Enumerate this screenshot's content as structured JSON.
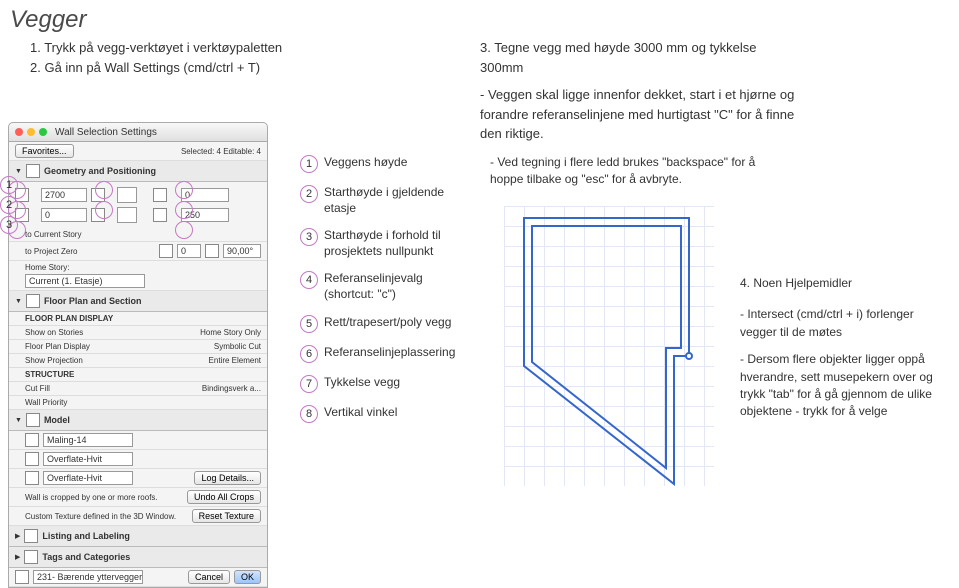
{
  "title": "Vegger",
  "steps_left": {
    "s1": "1. Trykk på vegg-verktøyet i verktøypaletten",
    "s2": "2. Gå inn på Wall Settings (cmd/ctrl + T)"
  },
  "step3": {
    "lead": "3. Tegne vegg med høyde 3000 mm og tykkelse 300mm",
    "d1": "- Veggen skal ligge innenfor dekket, start i et hjørne og forandre referanselinjene med hurtigtast \"C\" for å finne den riktige."
  },
  "note_backspace": "- Ved tegning i flere ledd brukes \"backspace\" for å hoppe tilbake og \"esc\" for å avbryte.",
  "help": {
    "title": "4. Noen Hjelpemidler",
    "p1": "- Intersect (cmd/ctrl + i) forlenger vegger til de møtes",
    "p2": "- Dersom flere objekter ligger oppå hverandre, sett musepekern over og trykk \"tab\" for å gå gjennom de ulike objektene - trykk for å velge"
  },
  "legend": {
    "i1": "Veggens høyde",
    "i2": "Starthøyde i gjeldende etasje",
    "i3": "Starthøyde i forhold til prosjektets nullpunkt",
    "i4": "Referanselinjevalg (shortcut: \"c\")",
    "i5": "Rett/trapesert/poly vegg",
    "i6": "Referanselinjeplassering",
    "i7": "Tykkelse vegg",
    "i8": "Vertikal vinkel"
  },
  "panel": {
    "window_title": "Wall Selection Settings",
    "favorites": "Favorites...",
    "selected": "Selected: 4 Editable: 4",
    "sec_geom": "Geometry and Positioning",
    "val_height": "2700",
    "val_offset": "0",
    "val_start": "0",
    "val_thick": "250",
    "to_current": "to Current Story",
    "to_zero": "to Project Zero",
    "val_zero": "0",
    "val_angle": "90,00°",
    "home_story": "Home Story:",
    "home_story_val": "Current (1. Etasje)",
    "sec_floor": "Floor Plan and Section",
    "fpd": "FLOOR PLAN DISPLAY",
    "show_on": "Show on Stories",
    "show_on_val": "Home Story Only",
    "fpd2": "Floor Plan Display",
    "fpd2_val": "Symbolic Cut",
    "show_proj": "Show Projection",
    "show_proj_val": "Entire Element",
    "structure": "STRUCTURE",
    "cut_fill": "Cut Fill",
    "cut_fill_val": "Bindingsverk a...",
    "wall_priority": "Wall Priority",
    "sec_model": "Model",
    "maling": "Maling-14",
    "overflate1": "Overflate-Hvit",
    "overflate2": "Overflate-Hvit",
    "crop_msg": "Wall is cropped by one or more roofs.",
    "undo_crops": "Undo All Crops",
    "log_details": "Log Details...",
    "custom_tex": "Custom Texture defined in the 3D Window.",
    "reset_tex": "Reset Texture",
    "sec_listing": "Listing and Labeling",
    "sec_tags": "Tags and Categories",
    "layer": "231- Bærende yttervegger",
    "cancel": "Cancel",
    "ok": "OK"
  }
}
